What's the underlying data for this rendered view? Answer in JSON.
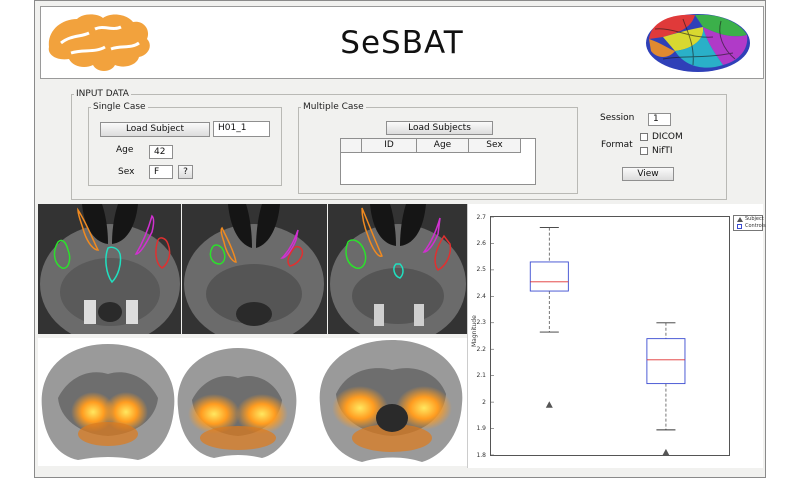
{
  "app": {
    "title": "SeSBAT"
  },
  "input_data": {
    "legend": "INPUT DATA",
    "single_case": {
      "legend": "Single Case",
      "load_subject_label": "Load Subject",
      "subject_id": "H01_1",
      "age_label": "Age",
      "age_value": "42",
      "sex_label": "Sex",
      "sex_value": "F",
      "help_label": "?"
    },
    "multiple_case": {
      "legend": "Multiple Case",
      "load_subjects_label": "Load Subjects",
      "columns": [
        "ID",
        "Age",
        "Sex"
      ]
    },
    "session_label": "Session",
    "session_value": "1",
    "format_label": "Format",
    "format_options": [
      "DICOM",
      "NifTI"
    ],
    "view_label": "View"
  },
  "plot": {
    "ylabel": "Magnitude",
    "legend": [
      "Subject",
      "Controls"
    ]
  },
  "chart_data": {
    "type": "box",
    "ylabel": "Magnitude",
    "ylim": [
      1.8,
      2.7
    ],
    "yticks": [
      "2.7",
      "2.6",
      "2.5",
      "2.4",
      "2.3",
      "2.2",
      "2.1",
      "2",
      "1.9",
      "1.8"
    ],
    "legend_entries": [
      "Subject",
      "Controls"
    ],
    "legend_position": "top-right",
    "boxes": [
      {
        "whisker_low": 2.265,
        "q1": 2.42,
        "median": 2.455,
        "q3": 2.53,
        "whisker_high": 2.66,
        "outlier": 1.99,
        "color": "#3b4bd1"
      },
      {
        "whisker_low": 1.895,
        "q1": 2.07,
        "median": 2.16,
        "q3": 2.24,
        "whisker_high": 2.3,
        "outlier": 1.81,
        "color": "#3b4bd1"
      }
    ],
    "median_color": "#e03030"
  }
}
